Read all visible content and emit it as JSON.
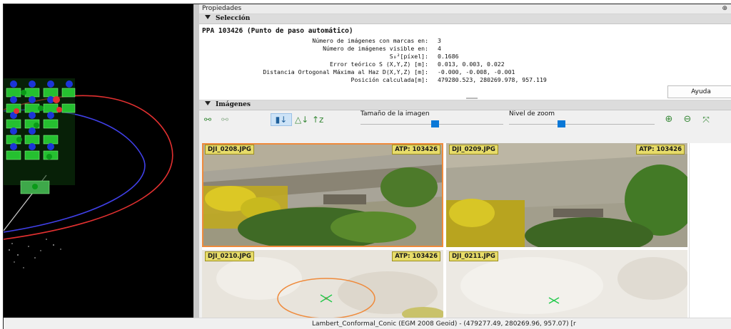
{
  "panel": {
    "title": "Propiedades"
  },
  "seleccion": {
    "header": "Selección",
    "title": "PPA 103426 (Punto de paso automático)",
    "rows": [
      {
        "label": "Número de imágenes con marcas en:",
        "value": "3"
      },
      {
        "label": "Número de imágenes visible en:",
        "value": "4"
      },
      {
        "label": "S₀²[píxel]:",
        "value": "0.1686"
      },
      {
        "label": "Error teórico S (X,Y,Z) [m]:",
        "value": "0.013, 0.003, 0.022"
      },
      {
        "label": "Distancia Ortogonal Máxima al Haz D(X,Y,Z) [m]:",
        "value": "-0.000, -0.008, -0.001"
      },
      {
        "label": "Posición calculada[m]:",
        "value": "479280.523, 280269.978, 957.119"
      }
    ],
    "help_button": "Ayuda"
  },
  "imagenes": {
    "header": "Imágenes",
    "image_size_label": "Tamaño de la imagen",
    "zoom_label": "Nivel de zoom",
    "image_size_level": 0.52,
    "zoom_level": 0.36,
    "icons": [
      "link-icon",
      "unlink-icon",
      "sort-marked-icon",
      "sort-error-icon",
      "sort-az-icon",
      "zoom-in-icon",
      "zoom-out-icon",
      "fit-icon"
    ],
    "thumbnails": [
      {
        "name": "DJI_0208.JPG",
        "atp": "ATP: 103426",
        "selected": true
      },
      {
        "name": "DJI_0209.JPG",
        "atp": "ATP: 103426",
        "selected": false
      },
      {
        "name": "DJI_0210.JPG",
        "atp": "ATP: 103426",
        "selected": false
      },
      {
        "name": "DJI_0211.JPG",
        "atp": "",
        "selected": false
      }
    ]
  },
  "status": {
    "text": "Lambert_Conformal_Conic (EGM 2008 Geoid) - (479277.49, 280269.96, 957.07) [r"
  },
  "colors": {
    "accent": "#0a78d7",
    "selection_outline": "#ef8a3b",
    "tag_bg": "#e7dc6a",
    "marker": "#22c94b"
  }
}
